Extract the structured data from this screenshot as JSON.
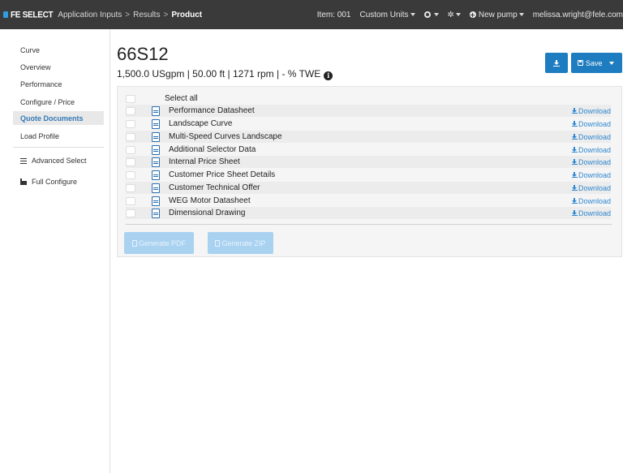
{
  "navbar": {
    "brand": "FE SELECT",
    "breadcrumbs": [
      "Application Inputs",
      "Results"
    ],
    "breadcrumb_separator": ">",
    "current": "Product",
    "item": "Item: 001",
    "units": "Custom Units",
    "new_pump": "New pump",
    "user": "melissa.wright@fele.com"
  },
  "sidebar": {
    "items": [
      {
        "label": "Curve"
      },
      {
        "label": "Overview"
      },
      {
        "label": "Performance"
      },
      {
        "label": "Configure / Price"
      },
      {
        "label": "Quote Documents"
      },
      {
        "label": "Load Profile"
      },
      {
        "label": "Advanced Select"
      },
      {
        "label": "Full Configure"
      }
    ]
  },
  "product": {
    "title": "66S12",
    "subtitle": "1,500.0 USgpm | 50.00 ft | 1271 rpm  |  - % TWE",
    "info_glyph": "i"
  },
  "actions": {
    "save_label": "Save"
  },
  "documents": {
    "select_all": "Select all",
    "download_label": "Download",
    "items": [
      "Performance Datasheet",
      "Landscape Curve",
      "Multi-Speed Curves Landscape",
      "Additional Selector Data",
      "Internal Price Sheet",
      "Customer Price Sheet Details",
      "Customer Technical Offer",
      "WEG Motor Datasheet",
      "Dimensional Drawing"
    ],
    "generate_pdf": "Generate PDF",
    "generate_zip": "Generate ZIP"
  },
  "colors": {
    "navbar": "#3a3a3a",
    "accent": "#1e7cc0",
    "link": "#2f86cf",
    "disabled_button": "#a9d2f1"
  }
}
